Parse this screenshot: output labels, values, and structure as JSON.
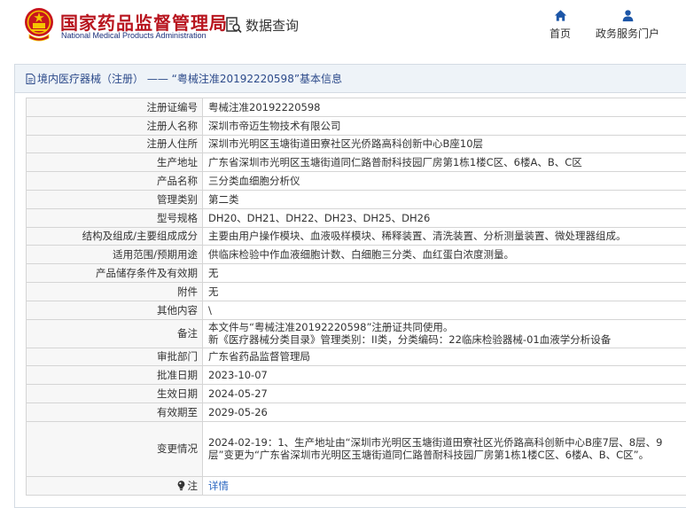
{
  "header": {
    "title": "国家药品监督管理局",
    "subtitle": "National Medical Products Administration",
    "query_label": "数据查询",
    "nav": [
      {
        "label": "首页"
      },
      {
        "label": "政务服务门户"
      }
    ]
  },
  "panel": {
    "breadcrumb": "境内医疗器械（注册） —— “粤械注准20192220598”基本信息"
  },
  "rows": [
    {
      "label": "注册证编号",
      "value": "粤械注准20192220598"
    },
    {
      "label": "注册人名称",
      "value": "深圳市帝迈生物技术有限公司"
    },
    {
      "label": "注册人住所",
      "value": "深圳市光明区玉塘街道田寮社区光侨路高科创新中心B座10层"
    },
    {
      "label": "生产地址",
      "value": "广东省深圳市光明区玉塘街道同仁路普耐科技园厂房第1栋1楼C区、6楼A、B、C区"
    },
    {
      "label": "产品名称",
      "value": "三分类血细胞分析仪"
    },
    {
      "label": "管理类别",
      "value": "第二类"
    },
    {
      "label": "型号规格",
      "value": "DH20、DH21、DH22、DH23、DH25、DH26"
    },
    {
      "label": "结构及组成/主要组成成分",
      "value": "主要由用户操作模块、血液吸样模块、稀释装置、清洗装置、分析测量装置、微处理器组成。"
    },
    {
      "label": "适用范围/预期用途",
      "value": "供临床检验中作血液细胞计数、白细胞三分类、血红蛋白浓度测量。"
    },
    {
      "label": "产品储存条件及有效期",
      "value": "无"
    },
    {
      "label": "附件",
      "value": "无"
    },
    {
      "label": "其他内容",
      "value": "\\"
    },
    {
      "label": "备注",
      "value_line1": "本文件与“粤械注准20192220598”注册证共同使用。",
      "value_line2": "新《医疗器械分类目录》管理类别：II类，分类编码：22临床检验器械-01血液学分析设备"
    },
    {
      "label": "审批部门",
      "value": "广东省药品监督管理局"
    },
    {
      "label": "批准日期",
      "value": "2023-10-07"
    },
    {
      "label": "生效日期",
      "value": "2024-05-27"
    },
    {
      "label": "有效期至",
      "value": "2029-05-26"
    },
    {
      "label": "变更情况",
      "value": "2024-02-19：1、生产地址由“深圳市光明区玉塘街道田寮社区光侨路高科创新中心B座7层、8层、9层”变更为“广东省深圳市光明区玉塘街道同仁路普耐科技园厂房第1栋1楼C区、6楼A、B、C区”。"
    },
    {
      "label": "注",
      "value": "详情"
    }
  ],
  "colors": {
    "brand_red": "#b8141e",
    "brand_blue": "#1a2f7a",
    "link_blue": "#2a66c0",
    "panel_head_bg": "#eef3f8"
  }
}
